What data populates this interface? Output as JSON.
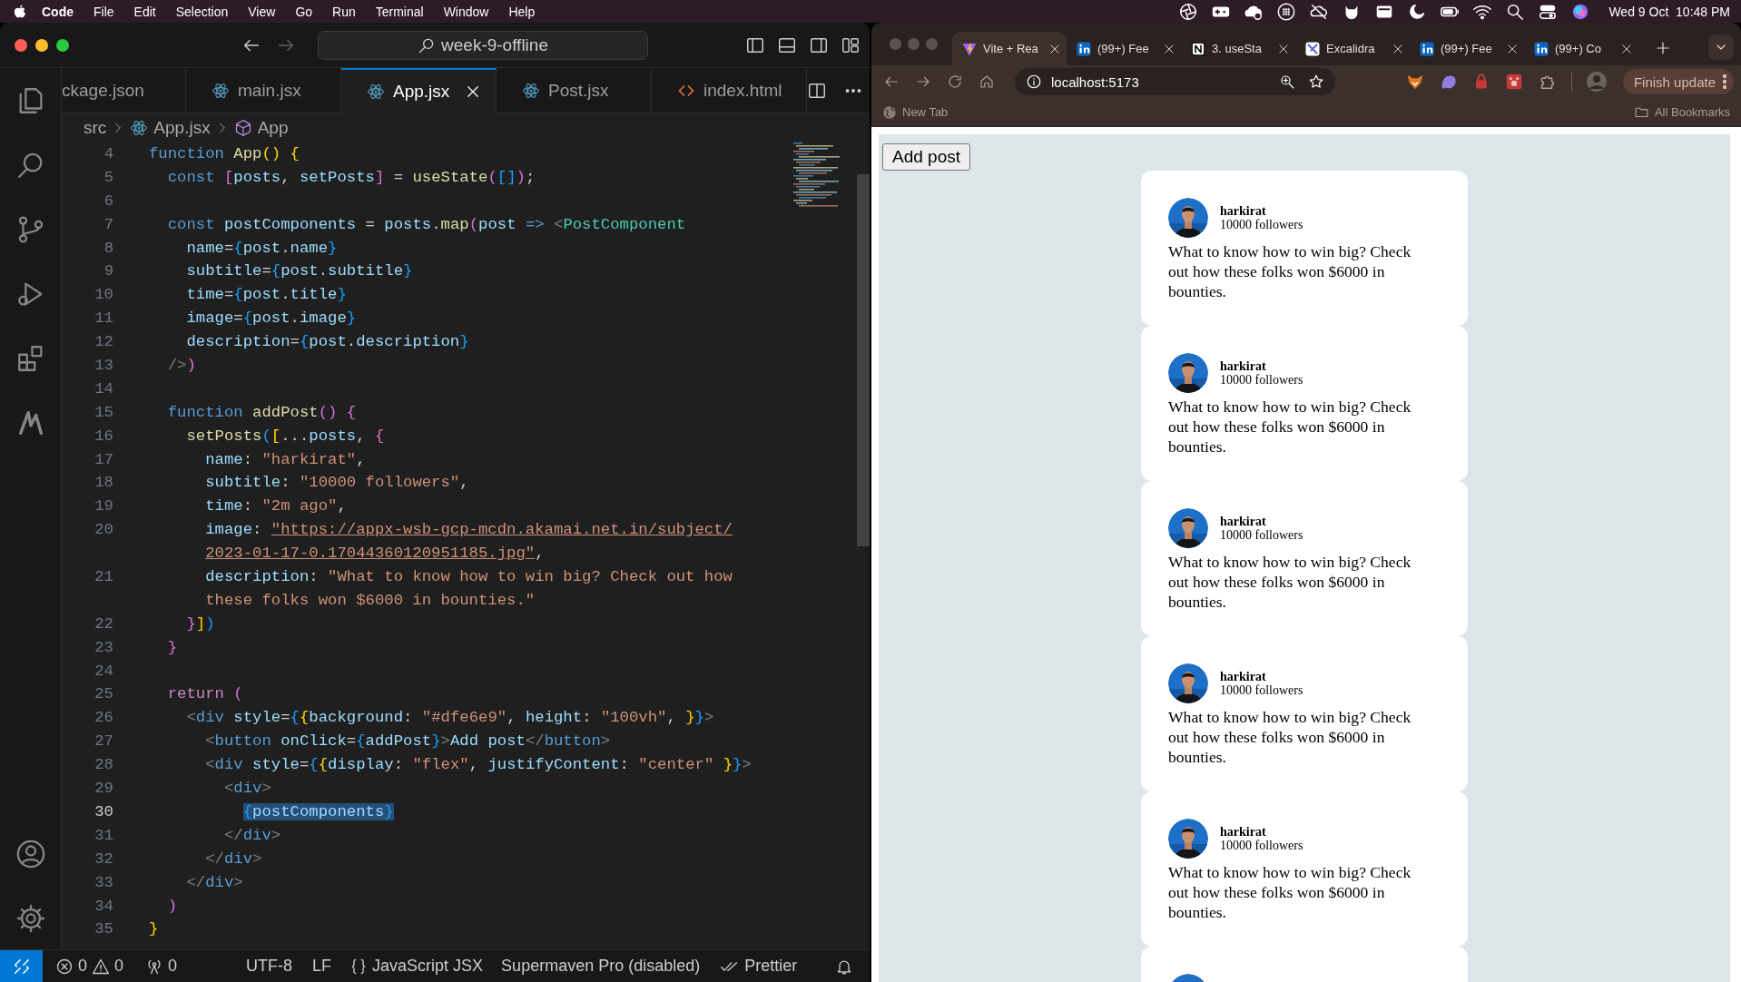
{
  "menu_bar": {
    "app": "Code",
    "items": [
      "File",
      "Edit",
      "Selection",
      "View",
      "Go",
      "Run",
      "Terminal",
      "Window",
      "Help"
    ],
    "clock": "Wed 9 Oct  10:48 PM"
  },
  "editor": {
    "search": "week-9-offline",
    "tabs": [
      {
        "label": "ckage.json",
        "selected": false
      },
      {
        "label": "main.jsx",
        "kind": "react",
        "selected": false
      },
      {
        "label": "App.jsx",
        "kind": "react",
        "selected": true
      },
      {
        "label": "Post.jsx",
        "kind": "react",
        "selected": false
      },
      {
        "label": "index.html",
        "kind": "html",
        "selected": false
      }
    ],
    "breadcrumb": [
      {
        "label": "src"
      },
      {
        "label": "App.jsx",
        "kind": "react"
      },
      {
        "label": "App",
        "kind": "component"
      }
    ],
    "lines": [
      {
        "number": "4",
        "text": "function App() {"
      },
      {
        "number": "5",
        "text": "  const [posts, setPosts] = useState([]);"
      },
      {
        "number": "6"
      },
      {
        "number": "7",
        "text": "  const postComponents = posts.map(post => <PostComponent"
      },
      {
        "number": "8",
        "text": "    name={post.name}"
      },
      {
        "number": "9",
        "text": "    subtitle={post.subtitle}"
      },
      {
        "number": "10",
        "text": "    time={post.title}"
      },
      {
        "number": "11",
        "text": "    image={post.image}"
      },
      {
        "number": "12",
        "text": "    description={post.description}"
      },
      {
        "number": "13",
        "text": "  />)"
      },
      {
        "number": "14"
      },
      {
        "number": "15",
        "text": "  function addPost() {"
      },
      {
        "number": "16",
        "text": "    setPosts([...posts, {"
      },
      {
        "number": "17",
        "text": "      name: \"harkirat\","
      },
      {
        "number": "18",
        "text": "      subtitle: \"10000 followers\","
      },
      {
        "number": "19",
        "text": "      time: \"2m ago\","
      },
      {
        "number": "20",
        "text": "      image: \"https://appx-wsb-gcp-mcdn.akamai.net.in/subject/",
        "wrap": "2023-01-17-0.17044360120951185.jpg\",",
        "link": true
      },
      {
        "number": "21",
        "text": "      description: \"What to know how to win big? Check out how",
        "wrap": "these folks won $6000 in bounties.\""
      },
      {
        "number": "22",
        "text": "    }])"
      },
      {
        "number": "23",
        "text": "  }"
      },
      {
        "number": "24"
      },
      {
        "number": "25",
        "text": "  return ("
      },
      {
        "number": "26",
        "text": "    <div style={{background: \"#dfe6e9\", height: \"100vh\", }}>"
      },
      {
        "number": "27",
        "text": "      <button onClick={addPost}>Add post</button>"
      },
      {
        "number": "28",
        "text": "      <div style={{display: \"flex\", justifyContent: \"center\" }}>"
      },
      {
        "number": "29",
        "text": "        <div>"
      },
      {
        "number": "30",
        "text": "          {postComponents}",
        "current": true,
        "selection": true
      },
      {
        "number": "31",
        "text": "        </div>"
      },
      {
        "number": "32",
        "text": "      </div>"
      },
      {
        "number": "33",
        "text": "    </div>"
      },
      {
        "number": "34",
        "text": "  )"
      },
      {
        "number": "35",
        "text": "}"
      }
    ],
    "status_bar": {
      "errors": "0",
      "warnings": "0",
      "ports": "0",
      "encoding": "UTF-8",
      "eol": "LF",
      "language": "JavaScript JSX",
      "extension": "Supermaven Pro (disabled)",
      "formatter": "Prettier"
    }
  },
  "browser": {
    "tabs": [
      {
        "label": "Vite + Rea",
        "kind": "vite",
        "selected": true
      },
      {
        "label": "(99+) Fee",
        "kind": "linkedin",
        "selected": false
      },
      {
        "label": "3. useSta",
        "kind": "notion",
        "selected": false
      },
      {
        "label": "Excalidra",
        "kind": "excalidraw",
        "selected": false
      },
      {
        "label": "(99+) Fee",
        "kind": "linkedin",
        "selected": false
      },
      {
        "label": "(99+) Co",
        "kind": "linkedin",
        "selected": false
      }
    ],
    "address": "localhost:5173",
    "update_button": "Finish update",
    "bookmarks": [
      "New Tab"
    ],
    "all_bookmarks": "All Bookmarks",
    "page": {
      "button": "Add post",
      "posts": [
        {
          "kind": "post",
          "name": "harkirat",
          "subtitle": "10000 followers",
          "description": "What to know how to win big? Check out how these folks won $6000 in bounties."
        },
        {
          "kind": "post",
          "name": "harkirat",
          "subtitle": "10000 followers",
          "description": "What to know how to win big? Check out how these folks won $6000 in bounties."
        },
        {
          "kind": "post",
          "name": "harkirat",
          "subtitle": "10000 followers",
          "description": "What to know how to win big? Check out how these folks won $6000 in bounties."
        },
        {
          "kind": "post",
          "name": "harkirat",
          "subtitle": "10000 followers",
          "description": "What to know how to win big? Check out how these folks won $6000 in bounties."
        },
        {
          "kind": "post",
          "name": "harkirat",
          "subtitle": "10000 followers",
          "description": "What to know how to win big? Check out how these folks won $6000 in bounties."
        },
        {
          "kind": "cut"
        }
      ]
    }
  }
}
